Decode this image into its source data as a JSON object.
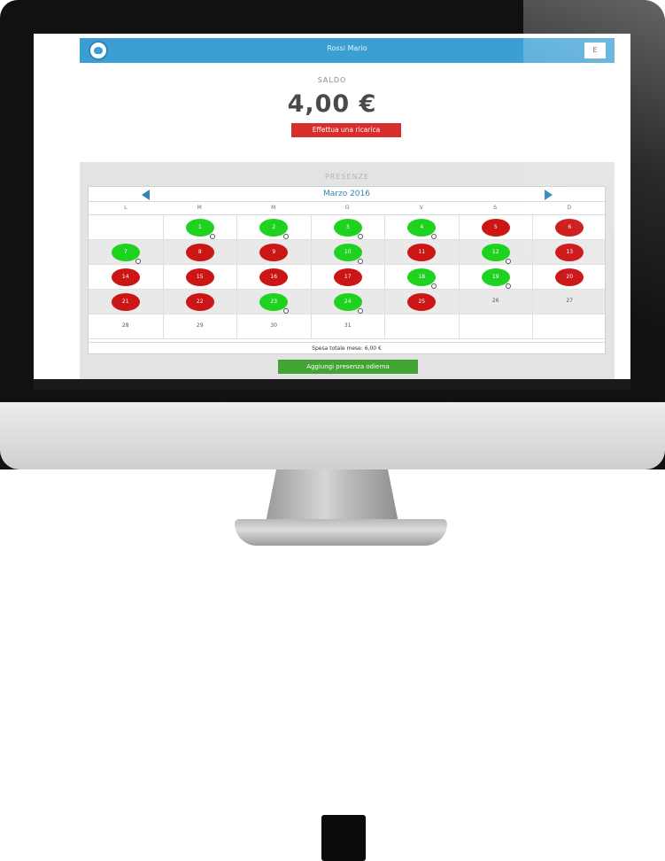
{
  "header": {
    "user_name": "Rossi Mario",
    "exit_label": "E"
  },
  "balance": {
    "label": "SALDO",
    "value": "4,00 €",
    "recharge_label": "Effettua una ricarica"
  },
  "presences": {
    "title": "PRESENZE",
    "month": "Marzo 2016",
    "weekdays": [
      "L",
      "M",
      "M",
      "G",
      "V",
      "S",
      "D"
    ],
    "weeks": [
      [
        {
          "day": "",
          "status": "empty"
        },
        {
          "day": "1",
          "status": "green"
        },
        {
          "day": "2",
          "status": "green"
        },
        {
          "day": "3",
          "status": "green"
        },
        {
          "day": "4",
          "status": "green"
        },
        {
          "day": "5",
          "status": "red"
        },
        {
          "day": "6",
          "status": "red"
        }
      ],
      [
        {
          "day": "7",
          "status": "green"
        },
        {
          "day": "8",
          "status": "red"
        },
        {
          "day": "9",
          "status": "red"
        },
        {
          "day": "10",
          "status": "green"
        },
        {
          "day": "11",
          "status": "red"
        },
        {
          "day": "12",
          "status": "green"
        },
        {
          "day": "13",
          "status": "red"
        }
      ],
      [
        {
          "day": "14",
          "status": "red"
        },
        {
          "day": "15",
          "status": "red"
        },
        {
          "day": "16",
          "status": "red"
        },
        {
          "day": "17",
          "status": "red"
        },
        {
          "day": "18",
          "status": "green"
        },
        {
          "day": "19",
          "status": "green"
        },
        {
          "day": "20",
          "status": "red"
        }
      ],
      [
        {
          "day": "21",
          "status": "red"
        },
        {
          "day": "22",
          "status": "red"
        },
        {
          "day": "23",
          "status": "green"
        },
        {
          "day": "24",
          "status": "green"
        },
        {
          "day": "25",
          "status": "red"
        },
        {
          "day": "26",
          "status": "plain"
        },
        {
          "day": "27",
          "status": "plain"
        }
      ],
      [
        {
          "day": "28",
          "status": "plain"
        },
        {
          "day": "29",
          "status": "plain"
        },
        {
          "day": "30",
          "status": "plain"
        },
        {
          "day": "31",
          "status": "plain"
        },
        {
          "day": "",
          "status": "empty"
        },
        {
          "day": "",
          "status": "empty"
        },
        {
          "day": "",
          "status": "empty"
        }
      ]
    ],
    "total_label": "Spesa totale mese: 6,00 €",
    "add_label": "Aggiungi presenza odierna"
  },
  "colors": {
    "header_blue": "#3b9fd4",
    "present_green": "#1fd21f",
    "absent_red": "#cc1515",
    "button_red": "#d92e2e",
    "button_green": "#44a335"
  }
}
